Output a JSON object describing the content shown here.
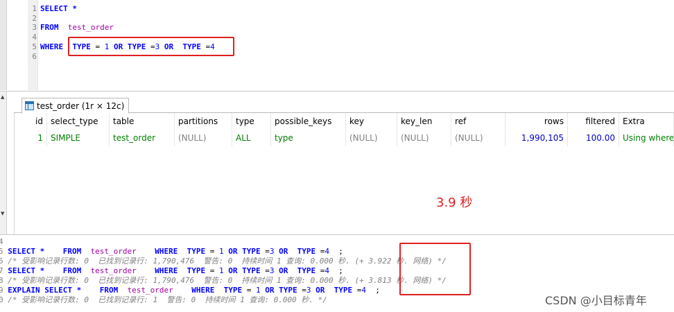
{
  "editor": {
    "line_numbers": [
      "1",
      "2",
      "3",
      "4",
      "5",
      "6"
    ],
    "lines": [
      [
        {
          "t": "SELECT *",
          "c": "kw"
        }
      ],
      [],
      [
        {
          "t": "FROM",
          "c": "kw"
        },
        {
          "t": "  ",
          "c": ""
        },
        {
          "t": "test_order",
          "c": "tbl"
        }
      ],
      [],
      [
        {
          "t": "WHERE",
          "c": "kw"
        },
        {
          "t": "  ",
          "c": ""
        },
        {
          "t": "TYPE",
          "c": "kw"
        },
        {
          "t": " = ",
          "c": ""
        },
        {
          "t": "1",
          "c": "num"
        },
        {
          "t": " ",
          "c": ""
        },
        {
          "t": "OR",
          "c": "kw"
        },
        {
          "t": " ",
          "c": ""
        },
        {
          "t": "TYPE",
          "c": "kw"
        },
        {
          "t": " =",
          "c": ""
        },
        {
          "t": "3",
          "c": "num"
        },
        {
          "t": " ",
          "c": ""
        },
        {
          "t": "OR",
          "c": "kw"
        },
        {
          "t": "  ",
          "c": ""
        },
        {
          "t": "TYPE",
          "c": "kw"
        },
        {
          "t": " =",
          "c": ""
        },
        {
          "t": "4",
          "c": "num"
        }
      ],
      []
    ]
  },
  "results": {
    "tab_label": "test_order (1r × 12c)",
    "columns": [
      "id",
      "select_type",
      "table",
      "partitions",
      "type",
      "possible_keys",
      "key",
      "key_len",
      "ref",
      "rows",
      "filtered",
      "Extra"
    ],
    "row": [
      "1",
      "SIMPLE",
      "test_order",
      "(NULL)",
      "ALL",
      "type",
      "(NULL)",
      "(NULL)",
      "(NULL)",
      "1,990,105",
      "100.00",
      "Using where"
    ]
  },
  "annotation": {
    "timing_note": "3.9 秒"
  },
  "messages": {
    "lines": [
      [
        {
          "t": "4",
          "c": "lnum"
        }
      ],
      [
        {
          "t": "5 ",
          "c": "lnum"
        },
        {
          "t": "SELECT *",
          "c": "kw"
        },
        {
          "t": "    ",
          "c": ""
        },
        {
          "t": "FROM",
          "c": "kw"
        },
        {
          "t": "  ",
          "c": ""
        },
        {
          "t": "test_order",
          "c": "tbl"
        },
        {
          "t": "    ",
          "c": ""
        },
        {
          "t": "WHERE",
          "c": "kw"
        },
        {
          "t": "  ",
          "c": ""
        },
        {
          "t": "TYPE",
          "c": "kw"
        },
        {
          "t": " = ",
          "c": ""
        },
        {
          "t": "1",
          "c": "num"
        },
        {
          "t": " ",
          "c": ""
        },
        {
          "t": "OR",
          "c": "kw"
        },
        {
          "t": " ",
          "c": ""
        },
        {
          "t": "TYPE",
          "c": "kw"
        },
        {
          "t": " =",
          "c": ""
        },
        {
          "t": "3",
          "c": "num"
        },
        {
          "t": " ",
          "c": ""
        },
        {
          "t": "OR",
          "c": "kw"
        },
        {
          "t": "  ",
          "c": ""
        },
        {
          "t": "TYPE",
          "c": "kw"
        },
        {
          "t": " =",
          "c": ""
        },
        {
          "t": "4",
          "c": "num"
        },
        {
          "t": "  ;",
          "c": ""
        }
      ],
      [
        {
          "t": "6 ",
          "c": "lnum"
        },
        {
          "t": "/* 受影响记录行数: 0  已找到记录行: 1,790,476  警告: 0  持续时间 1 查询: 0.000 秒. (+ 3.922 秒. 网络) */",
          "c": "cmt"
        }
      ],
      [
        {
          "t": "7 ",
          "c": "lnum"
        },
        {
          "t": "SELECT *",
          "c": "kw"
        },
        {
          "t": "    ",
          "c": ""
        },
        {
          "t": "FROM",
          "c": "kw"
        },
        {
          "t": "  ",
          "c": ""
        },
        {
          "t": "test_order",
          "c": "tbl"
        },
        {
          "t": "    ",
          "c": ""
        },
        {
          "t": "WHERE",
          "c": "kw"
        },
        {
          "t": "  ",
          "c": ""
        },
        {
          "t": "TYPE",
          "c": "kw"
        },
        {
          "t": " = ",
          "c": ""
        },
        {
          "t": "1",
          "c": "num"
        },
        {
          "t": " ",
          "c": ""
        },
        {
          "t": "OR",
          "c": "kw"
        },
        {
          "t": " ",
          "c": ""
        },
        {
          "t": "TYPE",
          "c": "kw"
        },
        {
          "t": " =",
          "c": ""
        },
        {
          "t": "3",
          "c": "num"
        },
        {
          "t": " ",
          "c": ""
        },
        {
          "t": "OR",
          "c": "kw"
        },
        {
          "t": "  ",
          "c": ""
        },
        {
          "t": "TYPE",
          "c": "kw"
        },
        {
          "t": " =",
          "c": ""
        },
        {
          "t": "4",
          "c": "num"
        },
        {
          "t": "  ;",
          "c": ""
        }
      ],
      [
        {
          "t": "8 ",
          "c": "lnum"
        },
        {
          "t": "/* 受影响记录行数: 0  已找到记录行: 1,790,476  警告: 0  持续时间 1 查询: 0.000 秒. (+ 3.813 秒. 网络) */",
          "c": "cmt"
        }
      ],
      [
        {
          "t": "9 ",
          "c": "lnum"
        },
        {
          "t": "EXPLAIN SELECT *",
          "c": "kw"
        },
        {
          "t": "    ",
          "c": ""
        },
        {
          "t": "FROM",
          "c": "kw"
        },
        {
          "t": "  ",
          "c": ""
        },
        {
          "t": "test_order",
          "c": "tbl"
        },
        {
          "t": "    ",
          "c": ""
        },
        {
          "t": "WHERE",
          "c": "kw"
        },
        {
          "t": "  ",
          "c": ""
        },
        {
          "t": "TYPE",
          "c": "kw"
        },
        {
          "t": " = ",
          "c": ""
        },
        {
          "t": "1",
          "c": "num"
        },
        {
          "t": " ",
          "c": ""
        },
        {
          "t": "OR",
          "c": "kw"
        },
        {
          "t": " ",
          "c": ""
        },
        {
          "t": "TYPE",
          "c": "kw"
        },
        {
          "t": " =",
          "c": ""
        },
        {
          "t": "3",
          "c": "num"
        },
        {
          "t": " ",
          "c": ""
        },
        {
          "t": "OR",
          "c": "kw"
        },
        {
          "t": "  ",
          "c": ""
        },
        {
          "t": "TYPE",
          "c": "kw"
        },
        {
          "t": " =",
          "c": ""
        },
        {
          "t": "4",
          "c": "num"
        },
        {
          "t": "  ;",
          "c": ""
        }
      ],
      [
        {
          "t": "0 ",
          "c": "lnum"
        },
        {
          "t": "/* 受影响记录行数: 0  已找到记录行: 1  警告: 0  持续时间 1 查询: 0.000 秒. */",
          "c": "cmt"
        }
      ]
    ]
  },
  "watermark": "CSDN @小目标青年",
  "colors": {
    "keyword": "#0000ff",
    "table_name": "#a000a0",
    "highlight": "#e02020",
    "result_text": "#008000"
  }
}
